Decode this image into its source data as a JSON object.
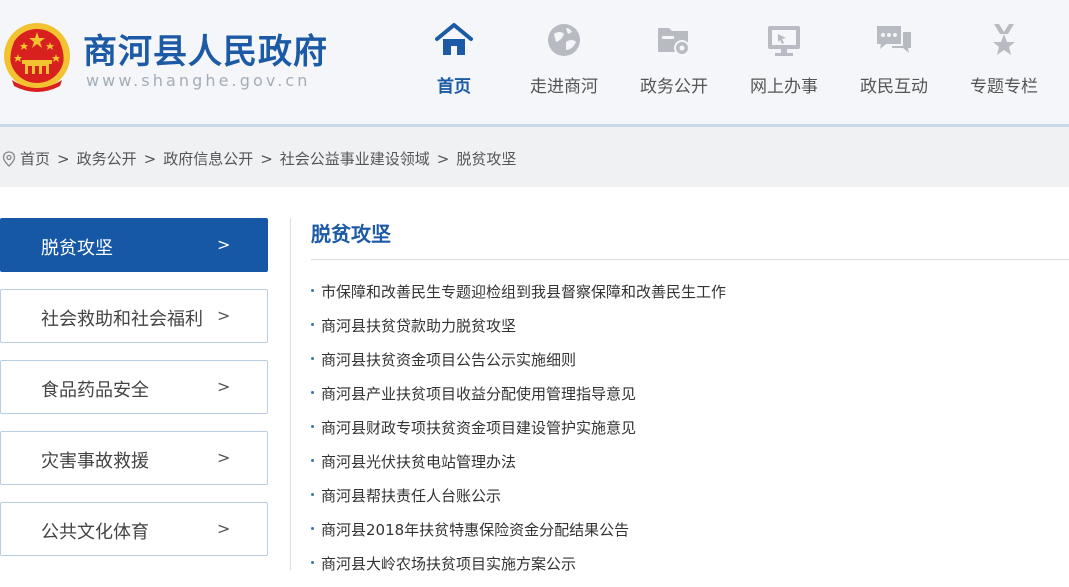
{
  "site": {
    "title": "商河县人民政府",
    "domain": "www.shanghe.gov.cn"
  },
  "nav": [
    {
      "label": "首页",
      "icon": "home-icon",
      "active": true
    },
    {
      "label": "走进商河",
      "icon": "globe-icon",
      "active": false
    },
    {
      "label": "政务公开",
      "icon": "folder-gear-icon",
      "active": false
    },
    {
      "label": "网上办事",
      "icon": "monitor-icon",
      "active": false
    },
    {
      "label": "政民互动",
      "icon": "chat-icon",
      "active": false
    },
    {
      "label": "专题专栏",
      "icon": "star-badge-icon",
      "active": false
    }
  ],
  "breadcrumb": [
    "首页",
    "政务公开",
    "政府信息公开",
    "社会公益事业建设领域",
    "脱贫攻坚"
  ],
  "breadcrumb_separator": ">",
  "sidebar": [
    {
      "label": "脱贫攻坚",
      "arrow": ">",
      "active": true
    },
    {
      "label": "社会救助和社会福利",
      "arrow": ">",
      "active": false
    },
    {
      "label": "食品药品安全",
      "arrow": ">",
      "active": false
    },
    {
      "label": "灾害事故救援",
      "arrow": ">",
      "active": false
    },
    {
      "label": "公共文化体育",
      "arrow": ">",
      "active": false
    }
  ],
  "main": {
    "title": "脱贫攻坚",
    "articles": [
      "市保障和改善民生专题迎检组到我县督察保障和改善民生工作",
      "商河县扶贫贷款助力脱贫攻坚",
      "商河县扶贫资金项目公告公示实施细则",
      "商河县产业扶贫项目收益分配使用管理指导意见",
      "商河县财政专项扶贫资金项目建设管护实施意见",
      "商河县光伏扶贫电站管理办法",
      "商河县帮扶责任人台账公示",
      "商河县2018年扶贫特惠保险资金分配结果公告",
      "商河县大岭农场扶贫项目实施方案公示"
    ]
  },
  "colors": {
    "brand": "#1c5aa6",
    "active_bg": "#1657a6",
    "emblem_red": "#d8201f",
    "emblem_gold": "#f2c230"
  }
}
